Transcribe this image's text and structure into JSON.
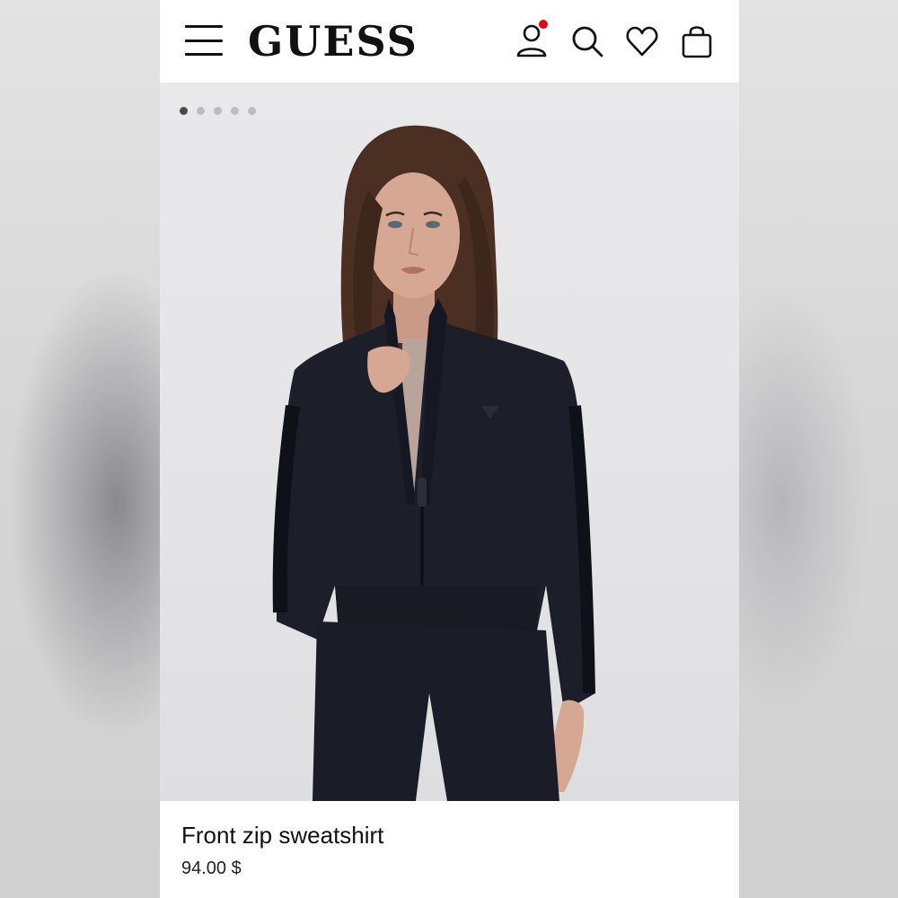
{
  "brand": {
    "logo_text": "GUESS"
  },
  "header": {
    "menu_icon": "hamburger-menu-icon",
    "account_icon": "user-account-icon",
    "search_icon": "search-icon",
    "wishlist_icon": "heart-icon",
    "cart_icon": "shopping-bag-icon",
    "notification_color": "#e30613"
  },
  "gallery": {
    "image_count": 5,
    "active_index": 0,
    "image_subject": "model wearing black front zip sweatshirt"
  },
  "product": {
    "name": "Front zip sweatshirt",
    "price": "94.00 $"
  },
  "colors": {
    "text": "#111111",
    "garment": "#1c1f2a",
    "background": "#ffffff"
  }
}
